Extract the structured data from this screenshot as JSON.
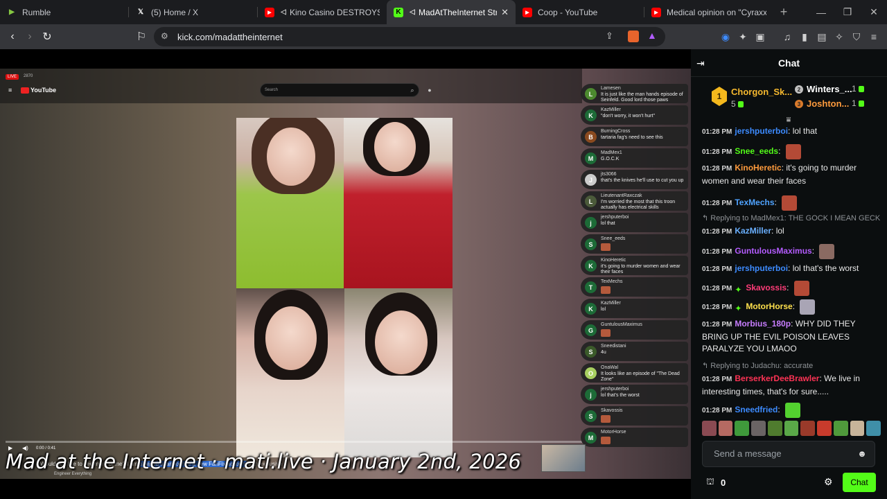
{
  "browser": {
    "tabs": [
      {
        "label": "Rumble",
        "icon": "rumble-icon",
        "color": "#85c742"
      },
      {
        "label": "(5) Home / X",
        "icon": "x-icon",
        "color": "#ffffff"
      },
      {
        "label": "Kino Casino DESTROYS DSP",
        "icon": "youtube-icon",
        "color": "#ff0000"
      },
      {
        "label": "MadAtTheInternet Stream",
        "icon": "kick-icon",
        "color": "#53fc18"
      },
      {
        "label": "Coop - YouTube",
        "icon": "youtube-icon",
        "color": "#ff0000"
      },
      {
        "label": "Medical opinion on \"Cyraxx\"'s m",
        "icon": "youtube-icon",
        "color": "#ff0000"
      }
    ],
    "url": "kick.com/madattheinternet"
  },
  "video": {
    "live_label": "LIVE",
    "viewers": "2870",
    "yt_logo": "YouTube",
    "search_placeholder": "Search",
    "time": "0:00 / 0:41",
    "caption_pre": "Would you like to see more of me? I am ",
    "caption_hl": "pleased to announce a new FanFix account",
    "caption_post": " with exclusive",
    "channel": "Engineer Everything",
    "overlay_title": "Mad at the Internet · mati.live · January 2nd, 2026"
  },
  "yt_chat": [
    {
      "initial": "L",
      "name": "Lamesen",
      "text": "It is just like the man hands episode of Seinfeld. Good lord those paws",
      "color": "#4c8a2f"
    },
    {
      "initial": "K",
      "name": "KazMiller",
      "text": "\"don't worry, it won't hurt\"",
      "color": "#1d6b37"
    },
    {
      "initial": "B",
      "name": "BurningCross",
      "text": "tartaria fag's need to see this",
      "color": "#8a4a1f"
    },
    {
      "initial": "M",
      "name": "MadMex1",
      "text": "G.O.C.K",
      "color": "#1d6b37"
    },
    {
      "initial": "J",
      "name": "jts3066",
      "text": "that's the knives he'll use to cut you up",
      "color": "#cccccc"
    },
    {
      "initial": "L",
      "name": "LieutenantRaxczak",
      "text": "I'm worried the most that this troon actually has electrical skills",
      "color": "#4b5a3a"
    },
    {
      "initial": "j",
      "name": "jershputerboi",
      "text": "lol that",
      "color": "#1d6b37"
    },
    {
      "initial": "S",
      "name": "Snee_eeds",
      "text": "",
      "color": "#1d6b37"
    },
    {
      "initial": "K",
      "name": "KinoHeretic",
      "text": "it's going to murder women and wear their faces",
      "color": "#1d6b37"
    },
    {
      "initial": "T",
      "name": "TexMechs",
      "text": "",
      "color": "#1d6b37"
    },
    {
      "initial": "K",
      "name": "KazMiller",
      "text": "lol",
      "color": "#1d6b37"
    },
    {
      "initial": "G",
      "name": "GuntulousMaximus",
      "text": "",
      "color": "#1d6b37"
    },
    {
      "initial": "S",
      "name": "Sneedistani",
      "text": "4u",
      "color": "#3b5a2a"
    },
    {
      "initial": "O",
      "name": "OnaWal",
      "text": "It looks like an episode of \"The Dead Zone\"",
      "color": "#a8d060"
    },
    {
      "initial": "j",
      "name": "jershputerboi",
      "text": "lol that's the worst",
      "color": "#1d6b37"
    },
    {
      "initial": "S",
      "name": "Skavossis",
      "text": "",
      "color": "#1d6b37"
    },
    {
      "initial": "M",
      "name": "MotorHorse",
      "text": "",
      "color": "#1d6b37"
    }
  ],
  "chat": {
    "title": "Chat",
    "leaderboard": [
      {
        "rank": "1",
        "name": "Chorgon_Sk...",
        "count": "5"
      },
      {
        "rank": "2",
        "name": "Winters_...",
        "count": "1"
      },
      {
        "rank": "3",
        "name": "Joshton...",
        "count": "1"
      }
    ],
    "messages": [
      {
        "time": "01:28 PM",
        "user": "jershputerboi",
        "color": "#3d8bff",
        "text": "lol that"
      },
      {
        "time": "01:28 PM",
        "user": "Snee_eeds",
        "color": "#53fc18",
        "text": "",
        "emote": true
      },
      {
        "time": "01:28 PM",
        "user": "KinoHeretic",
        "color": "#ff9b3d",
        "text": "it's going to murder women and wear their faces"
      },
      {
        "time": "01:28 PM",
        "user": "TexMechs",
        "color": "#4fa3ff",
        "text": "",
        "emote": true
      },
      {
        "time": "01:28 PM",
        "user": "KazMiller",
        "color": "#6ab0ff",
        "text": "lol",
        "reply": "Replying to MadMex1: THE GOCK I MEAN GECK"
      },
      {
        "time": "01:28 PM",
        "user": "GuntulousMaximus",
        "color": "#b45cff",
        "text": "",
        "emote": true
      },
      {
        "time": "01:28 PM",
        "user": "jershputerboi",
        "color": "#3d8bff",
        "text": "lol that's the worst"
      },
      {
        "time": "01:28 PM",
        "user": "Skavossis",
        "color": "#ff3c78",
        "text": "",
        "emote": true,
        "badge": true
      },
      {
        "time": "01:28 PM",
        "user": "MotorHorse",
        "color": "#ffe14d",
        "text": "",
        "emote": true,
        "badge": true
      },
      {
        "time": "01:28 PM",
        "user": "Morbius_180p",
        "color": "#c77dff",
        "text": "WHY DID THEY BRING UP THE EVIL POISON LEAVES PARALYZE YOU LMAOO"
      },
      {
        "time": "01:28 PM",
        "user": "BerserkerDeeBrawler",
        "color": "#ff3355",
        "text": "We live in interesting times, that's for sure.....",
        "reply": "Replying to Judachu: accurate"
      },
      {
        "time": "01:28 PM",
        "user": "Sneedfried",
        "color": "#3d8bff",
        "text": "",
        "emote": true
      }
    ],
    "send_placeholder": "Send a message",
    "points": "0",
    "chat_button": "Chat"
  }
}
